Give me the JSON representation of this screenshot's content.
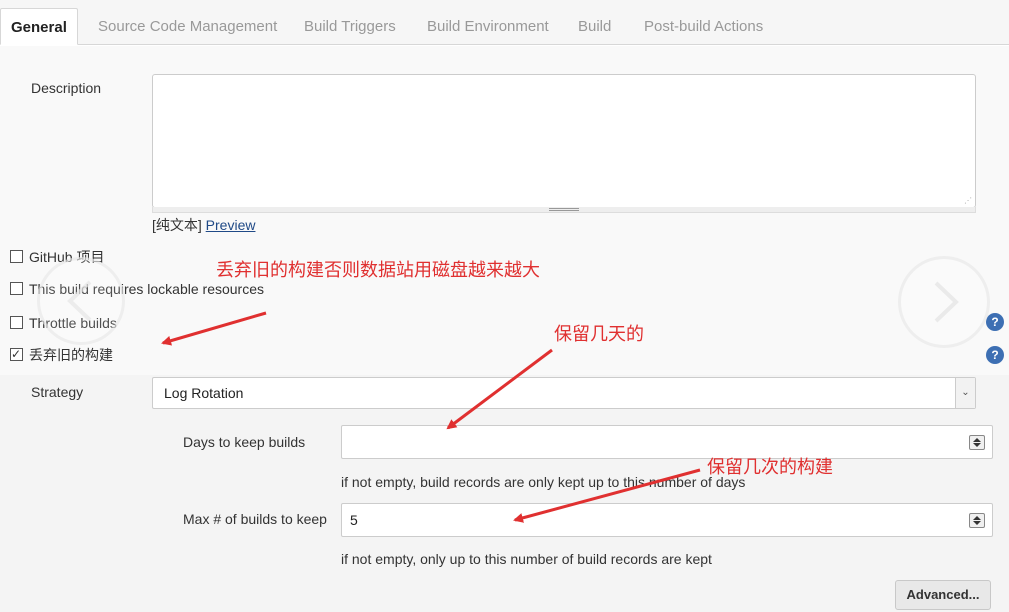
{
  "tabs": [
    {
      "label": "General"
    },
    {
      "label": "Source Code Management"
    },
    {
      "label": "Build Triggers"
    },
    {
      "label": "Build Environment"
    },
    {
      "label": "Build"
    },
    {
      "label": "Post-build Actions"
    }
  ],
  "description": {
    "label": "Description",
    "value": "",
    "format_prefix": "[纯文本]",
    "preview_link": "Preview"
  },
  "options": [
    {
      "label": "GitHub 项目",
      "checked": false
    },
    {
      "label": "This build requires lockable resources",
      "checked": false
    },
    {
      "label": "Throttle builds",
      "checked": false
    },
    {
      "label": "丢弃旧的构建",
      "checked": true
    }
  ],
  "strategy": {
    "label": "Strategy",
    "selected": "Log Rotation"
  },
  "days_to_keep": {
    "label": "Days to keep builds",
    "value": "",
    "hint": "if not empty, build records are only kept up to this number of days"
  },
  "max_builds": {
    "label": "Max # of builds to keep",
    "value": "5",
    "hint": "if not empty, only up to this number of build records are kept"
  },
  "advanced_button": "Advanced...",
  "help_icon_glyph": "?",
  "annotations": {
    "discard_note": "丢弃旧的构建否则数据站用磁盘越来越大",
    "days_note": "保留几天的",
    "count_note": "保留几次的构建"
  },
  "colors": {
    "annotation": "#e03030",
    "help_icon": "#3d6fb3",
    "link": "#204a87"
  }
}
